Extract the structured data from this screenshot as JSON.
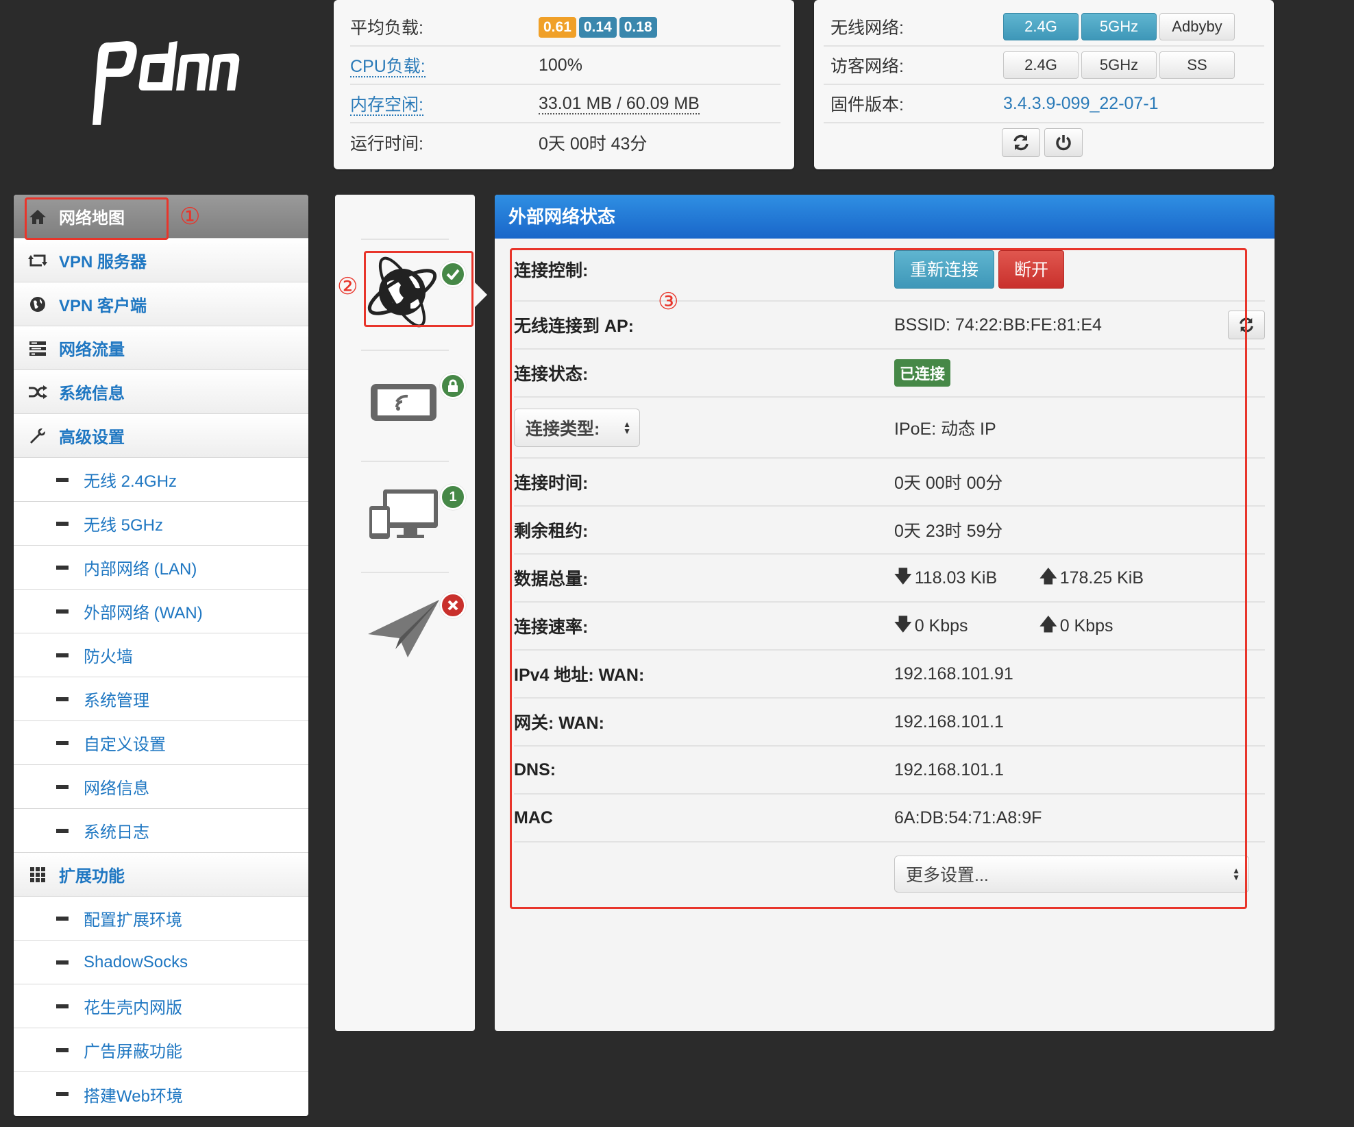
{
  "system": {
    "load_label": "平均负载:",
    "load_values": [
      "0.61",
      "0.14",
      "0.18"
    ],
    "cpu_label": "CPU负载:",
    "cpu_value": "100%",
    "mem_label": "内存空闲:",
    "mem_value": "33.01 MB / 60.09 MB",
    "uptime_label": "运行时间:",
    "uptime_value": "0天 00时 43分"
  },
  "wireless": {
    "wifi_label": "无线网络:",
    "wifi_buttons": [
      "2.4G",
      "5GHz",
      "Adbyby"
    ],
    "guest_label": "访客网络:",
    "guest_buttons": [
      "2.4G",
      "5GHz",
      "SS"
    ],
    "fw_label": "固件版本:",
    "fw_value": "3.4.3.9-099_22-07-1"
  },
  "sidebar": {
    "items": [
      {
        "label": "网络地图",
        "icon": "home-icon"
      },
      {
        "label": "VPN 服务器",
        "icon": "retweet-icon"
      },
      {
        "label": "VPN 客户端",
        "icon": "globe-icon"
      },
      {
        "label": "网络流量",
        "icon": "tasks-icon"
      },
      {
        "label": "系统信息",
        "icon": "random-icon"
      },
      {
        "label": "高级设置",
        "icon": "wrench-icon"
      }
    ],
    "advanced": [
      "无线 2.4GHz",
      "无线 5GHz",
      "内部网络 (LAN)",
      "外部网络 (WAN)",
      "防火墙",
      "系统管理",
      "自定义设置",
      "网络信息",
      "系统日志"
    ],
    "ext_label": "扩展功能",
    "ext_icon": "grid-icon",
    "ext": [
      "配置扩展环境",
      "ShadowSocks",
      "花生壳内网版",
      "广告屏蔽功能",
      "搭建Web环境"
    ]
  },
  "status_badges": {
    "clients_count": "1"
  },
  "wan": {
    "title": "外部网络状态",
    "control_label": "连接控制:",
    "reconnect": "重新连接",
    "disconnect": "断开",
    "ap_label": "无线连接到 AP:",
    "ap_value": "BSSID: 74:22:BB:FE:81:E4",
    "state_label": "连接状态:",
    "state_value": "已连接",
    "type_select": "连接类型:",
    "type_value": "IPoE: 动态 IP",
    "time_label": "连接时间:",
    "time_value": "0天 00时 00分",
    "lease_label": "剩余租约:",
    "lease_value": "0天 23时 59分",
    "total_label": "数据总量:",
    "total_down": "118.03 KiB",
    "total_up": "178.25 KiB",
    "rate_label": "连接速率:",
    "rate_down": "0 Kbps",
    "rate_up": "0 Kbps",
    "ipv4_label": "IPv4 地址: WAN:",
    "ipv4_value": "192.168.101.91",
    "gw_label": "网关: WAN:",
    "gw_value": "192.168.101.1",
    "dns_label": "DNS:",
    "dns_value": "192.168.101.1",
    "mac_label": "MAC",
    "mac_value": "6A:DB:54:71:A8:9F",
    "more_select": "更多设置..."
  },
  "annotations": [
    "①",
    "②",
    "③"
  ],
  "colors": {
    "accent": "#1f77c2",
    "header": "#1966c9",
    "annotation": "#e8352b",
    "ok": "#468847",
    "error": "#c9302c"
  }
}
